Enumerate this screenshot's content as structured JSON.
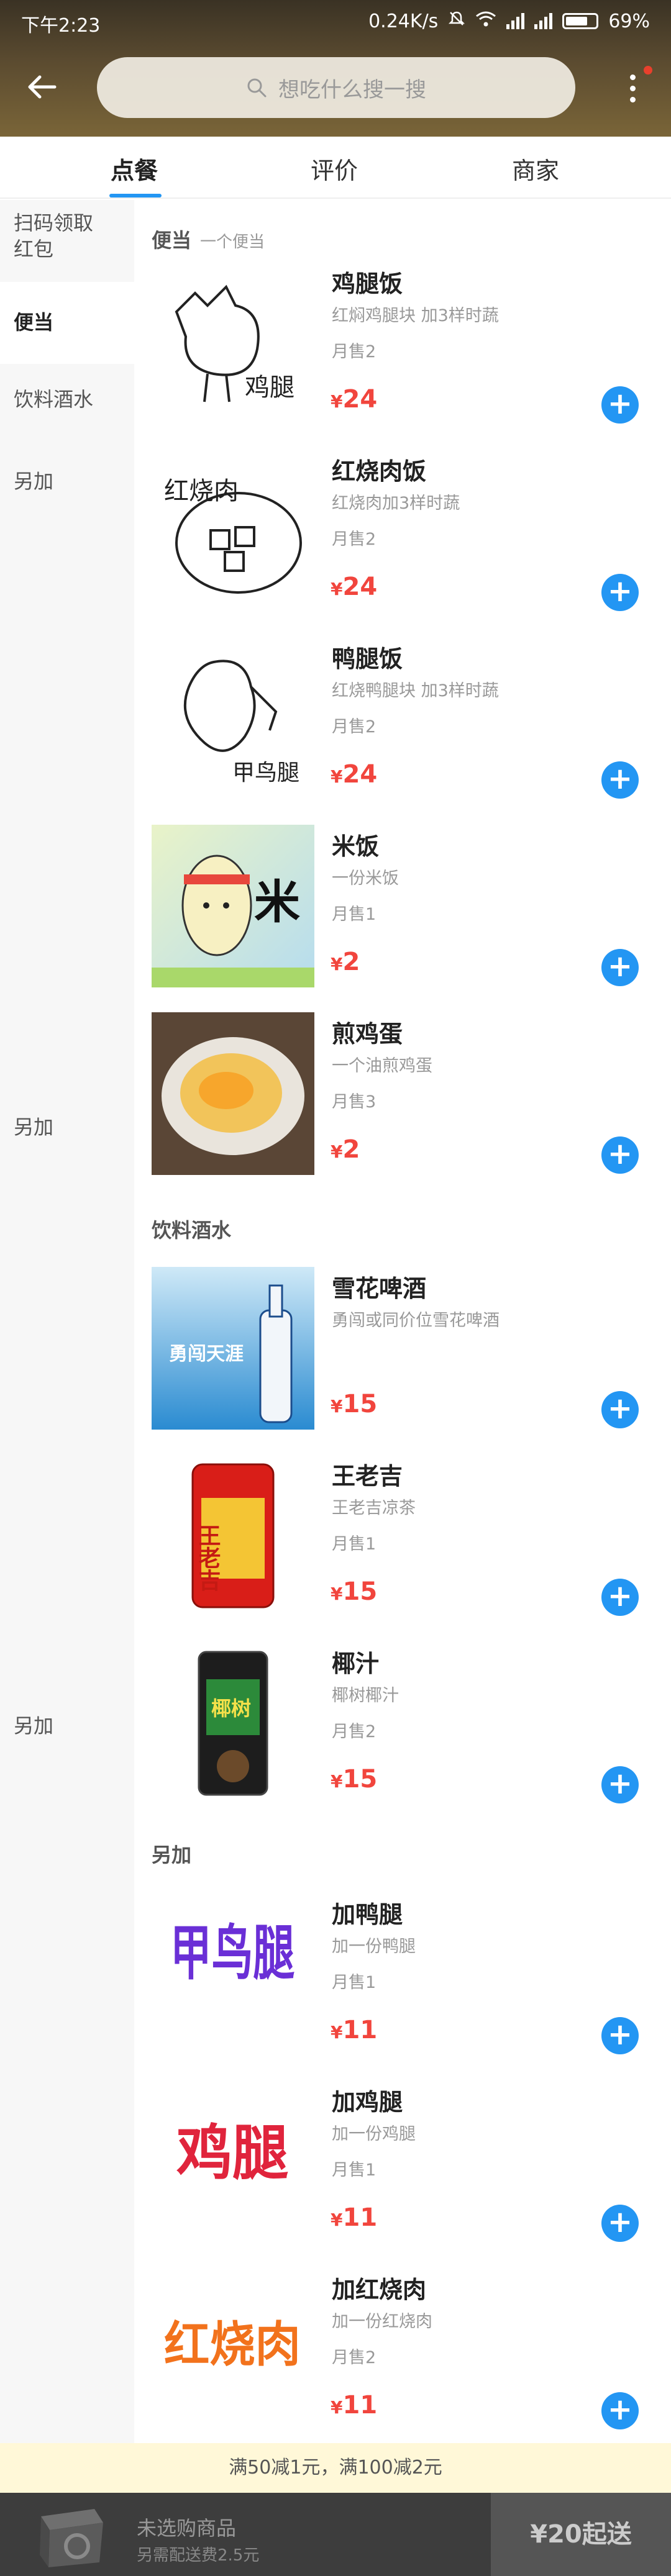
{
  "status_bar": {
    "time": "下午2:23",
    "speed": "0.24K/s",
    "battery": "69%"
  },
  "search": {
    "placeholder": "想吃什么搜一搜"
  },
  "tabs": [
    {
      "label": "点餐"
    },
    {
      "label": "评价"
    },
    {
      "label": "商家"
    }
  ],
  "sidebar": {
    "items": [
      {
        "label": "扫码领取红包"
      },
      {
        "label": "便当"
      },
      {
        "label": "饮料酒水"
      },
      {
        "label": "另加"
      }
    ],
    "repeat_labels": [
      "另加",
      "另加"
    ]
  },
  "sections": [
    {
      "title": "便当",
      "subtitle": "一个便当"
    },
    {
      "title": "饮料酒水",
      "subtitle": ""
    },
    {
      "title": "另加",
      "subtitle": ""
    }
  ],
  "items": [
    {
      "name": "鸡腿饭",
      "desc": "红焖鸡腿块 加3样时蔬",
      "sales": "月售2",
      "yen": "¥",
      "price": "24",
      "thumb_text": "鸡腿"
    },
    {
      "name": "红烧肉饭",
      "desc": "红烧肉加3样时蔬",
      "sales": "月售2",
      "yen": "¥",
      "price": "24",
      "thumb_text": "红烧肉"
    },
    {
      "name": "鸭腿饭",
      "desc": "红烧鸭腿块 加3样时蔬",
      "sales": "月售2",
      "yen": "¥",
      "price": "24",
      "thumb_text": "甲鸟腿"
    },
    {
      "name": "米饭",
      "desc": "一份米饭",
      "sales": "月售1",
      "yen": "¥",
      "price": "2",
      "thumb_text": "米"
    },
    {
      "name": "煎鸡蛋",
      "desc": "一个油煎鸡蛋",
      "sales": "月售3",
      "yen": "¥",
      "price": "2"
    },
    {
      "name": "雪花啤酒",
      "desc": "勇闯或同价位雪花啤酒",
      "sales": "",
      "yen": "¥",
      "price": "15",
      "thumb_text": "勇闯天涯"
    },
    {
      "name": "王老吉",
      "desc": "王老吉凉茶",
      "sales": "月售1",
      "yen": "¥",
      "price": "15",
      "thumb_text": "王老吉"
    },
    {
      "name": "椰汁",
      "desc": "椰树椰汁",
      "sales": "月售2",
      "yen": "¥",
      "price": "15",
      "thumb_text": "椰树"
    },
    {
      "name": "加鸭腿",
      "desc": "加一份鸭腿",
      "sales": "月售1",
      "yen": "¥",
      "price": "11",
      "thumb_text": "甲鸟腿"
    },
    {
      "name": "加鸡腿",
      "desc": "加一份鸡腿",
      "sales": "月售1",
      "yen": "¥",
      "price": "11",
      "thumb_text": "鸡腿"
    },
    {
      "name": "加红烧肉",
      "desc": "加一份红烧肉",
      "sales": "月售2",
      "yen": "¥",
      "price": "11",
      "thumb_text": "红烧肉"
    }
  ],
  "promo": {
    "text": "满50减1元，满100减2元"
  },
  "cart": {
    "status": "未选购商品",
    "delivery_fee": "另需配送费2.5元",
    "checkout_label": "¥20起送"
  },
  "colors": {
    "accent": "#2396f3",
    "price": "#f1453d"
  }
}
